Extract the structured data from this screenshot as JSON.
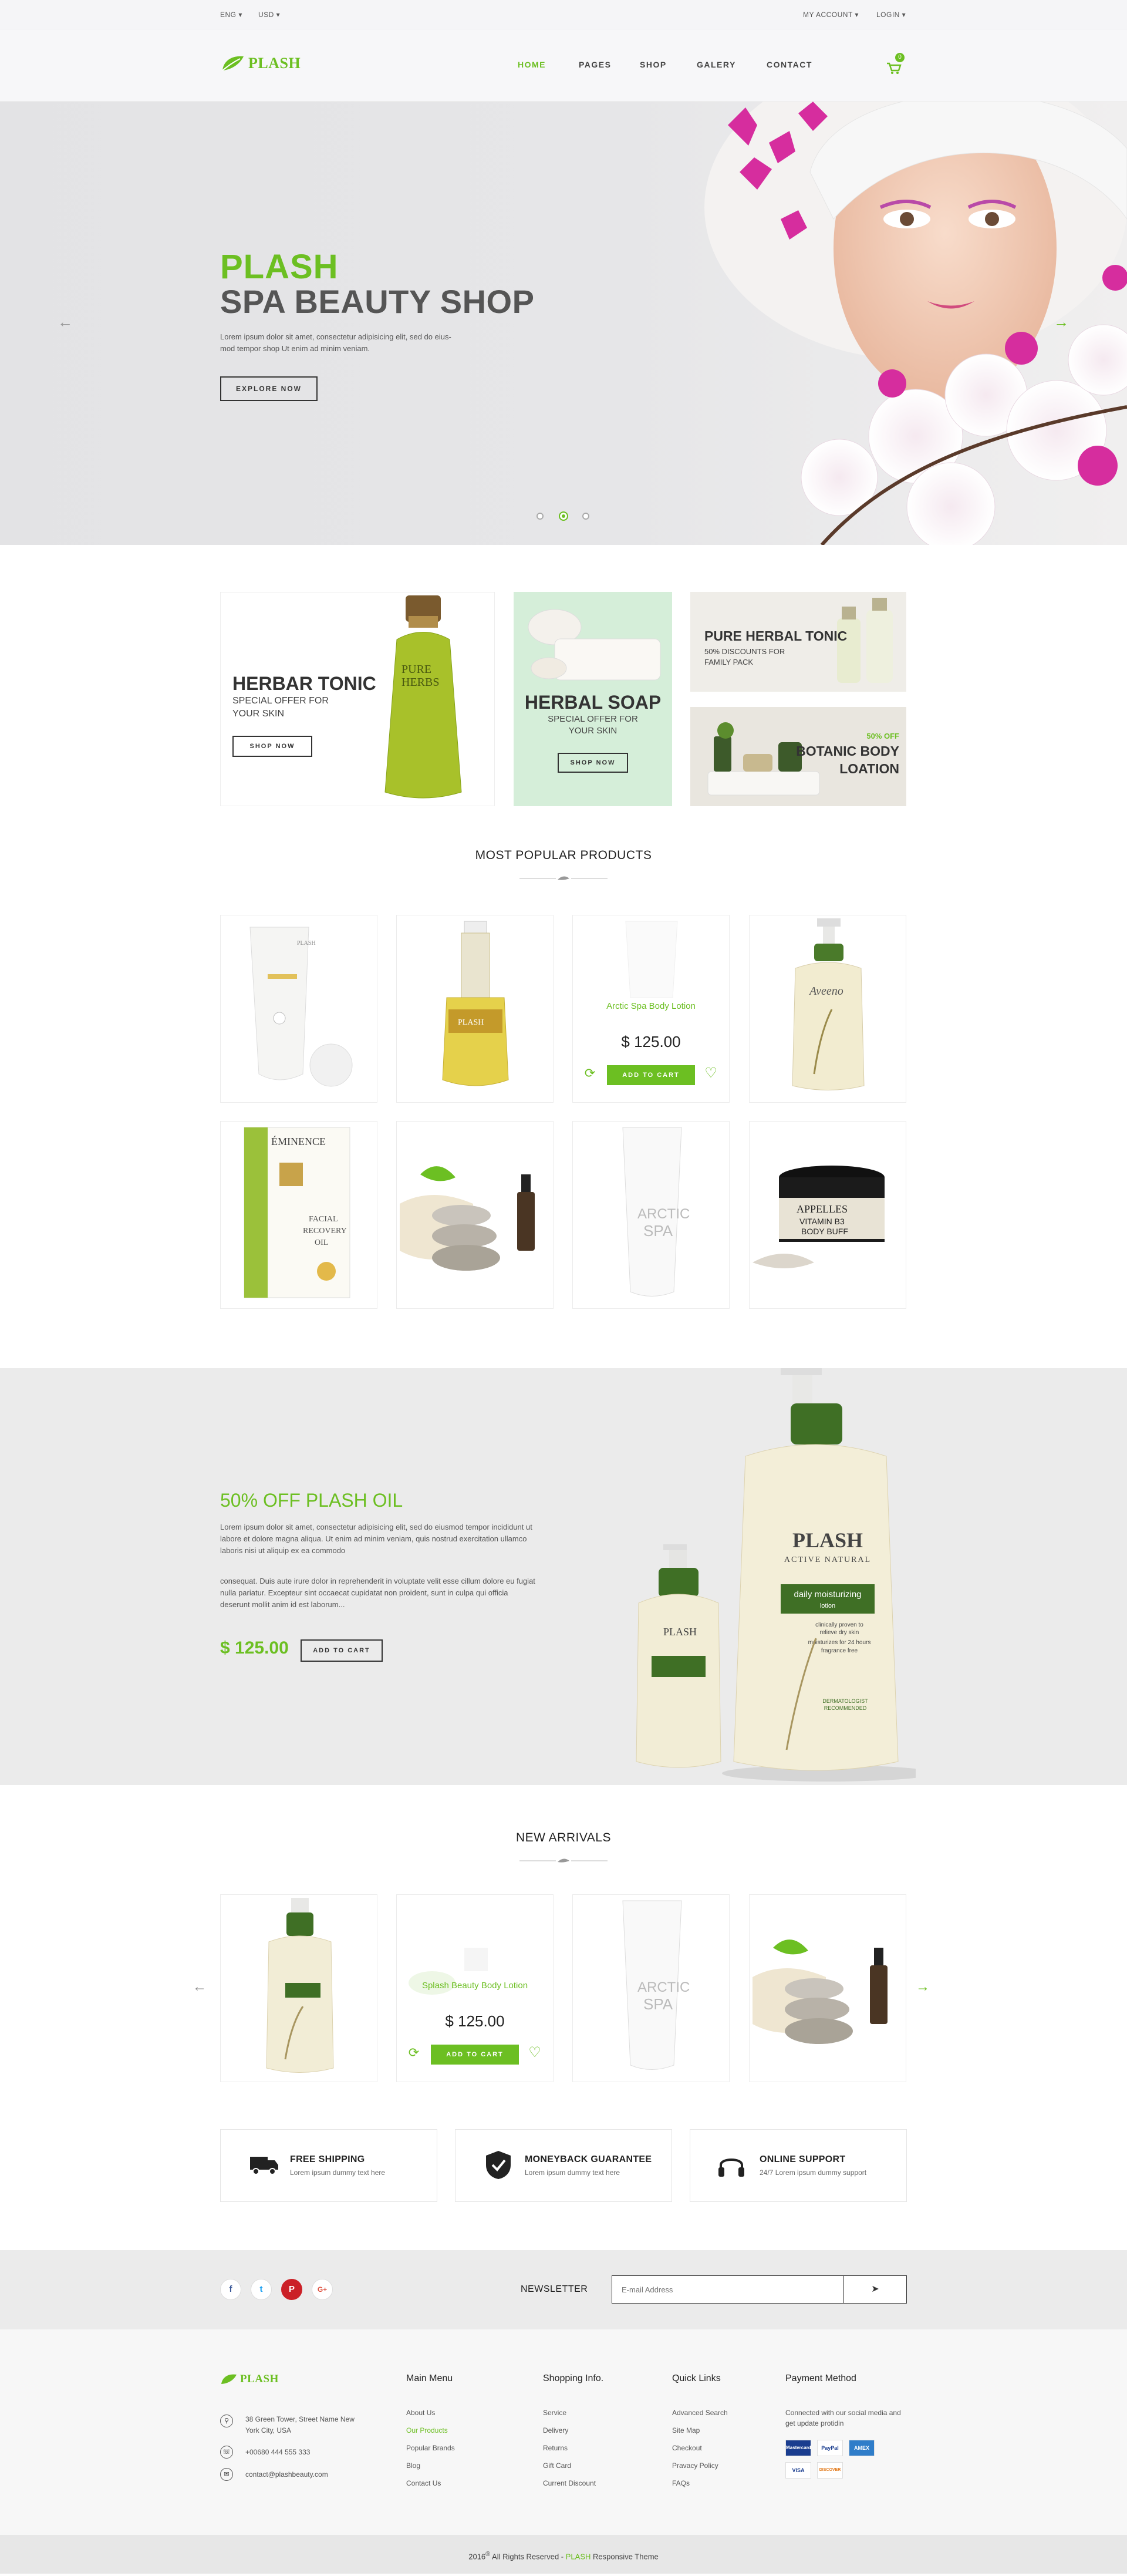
{
  "topbar": {
    "lang": "ENG",
    "currency": "USD",
    "account": "MY ACCOUNT",
    "login": "LOGIN"
  },
  "header": {
    "logo": "PLASH",
    "nav": [
      "HOME",
      "PAGES",
      "SHOP",
      "GALERY",
      "CONTACT"
    ],
    "cart_count": "0"
  },
  "hero": {
    "title_accent": "PLASH",
    "title_main": "SPA BEAUTY SHOP",
    "text_line1": "Lorem ipsum dolor sit amet, consectetur adipisicing elit, sed do eius-",
    "text_line2": "mod tempor shop Ut enim ad minim veniam.",
    "cta": "EXPLORE NOW",
    "slide_active": 2,
    "slide_count": 3
  },
  "promos": {
    "tonic": {
      "title": "HERBAR TONIC",
      "sub1": "SPECIAL OFFER FOR",
      "sub2": "YOUR SKIN",
      "cta": "SHOP NOW",
      "label1": "PURE",
      "label2": "HERBS"
    },
    "soap": {
      "title": "HERBAL SOAP",
      "sub1": "SPECIAL OFFER FOR",
      "sub2": "YOUR SKIN",
      "cta": "SHOP NOW"
    },
    "pure": {
      "title": "PURE HERBAL TONIC",
      "sub1": "50% DISCOUNTS FOR",
      "sub2": "FAMILY PACK"
    },
    "botanic": {
      "badge": "50% OFF",
      "title1": "BOTANIC BODY",
      "title2": "LOATION"
    }
  },
  "popular": {
    "title": "MOST POPULAR PRODUCTS",
    "hover_name": "Arctic Spa Body Lotion",
    "hover_price": "$ 125.00",
    "add_to_cart": "ADD TO CART",
    "labels": {
      "tube1": "PLASH",
      "serum": "PLASH",
      "aveeno": "Aveeno",
      "eminence1": "ÉMINENCE",
      "eminence2": "FACIAL",
      "eminence3": "RECOVERY",
      "eminence4": "OIL",
      "arctic1": "ARCTIC",
      "arctic2": "SPA",
      "appelles1": "APPELLES",
      "appelles2": "VITAMIN B3",
      "appelles3": "BODY BUFF"
    }
  },
  "offer": {
    "title": "50% OFF PLASH OIL",
    "p1_line1": "Lorem ipsum dolor sit amet, consectetur adipisicing elit, sed do eiusmod tempor incididunt ut",
    "p1_line2": "labore et dolore magna aliqua. Ut enim ad minim veniam, quis nostrud exercitation ullamco",
    "p1_line3": "laboris nisi ut aliquip ex ea commodo",
    "p2_line1": "consequat. Duis aute irure dolor in reprehenderit in voluptate velit esse cillum dolore eu fugiat",
    "p2_line2": "nulla pariatur. Excepteur sint occaecat cupidatat non proident, sunt in culpa qui officia",
    "p2_line3": "deserunt mollit anim id est laborum...",
    "price": "$ 125.00",
    "cta": "ADD TO CART",
    "bottle_brand": "PLASH",
    "bottle_sub": "ACTIVE NATURAL",
    "bottle_label1": "daily moisturizing",
    "bottle_label2": "lotion",
    "bottle_claim1": "clinically proven to",
    "bottle_claim2": "relieve dry skin",
    "bottle_claim3": "moisturizes for 24 hours",
    "bottle_claim4": "fragrance free",
    "bottle_badge1": "DERMATOLOGIST",
    "bottle_badge2": "RECOMMENDED"
  },
  "arrivals": {
    "title": "NEW ARRIVALS",
    "hover_name": "Splash Beauty Body Lotion",
    "hover_price": "$ 125.00",
    "add_to_cart": "ADD TO CART"
  },
  "features": [
    {
      "title": "FREE SHIPPING",
      "sub": "Lorem ipsum dummy text here"
    },
    {
      "title": "MONEYBACK GUARANTEE",
      "sub": "Lorem ipsum dummy text here"
    },
    {
      "title": "ONLINE SUPPORT",
      "sub": "24/7 Lorem ipsum dummy support"
    }
  ],
  "newsletter": {
    "label": "NEWSLETTER",
    "placeholder": "E-mail Address"
  },
  "footer": {
    "logo": "PLASH",
    "address1": "38 Green Tower, Street Name New",
    "address2": "York City, USA",
    "phone": "+00680 444 555 333",
    "email": "contact@plashbeauty.com",
    "col_menu": {
      "title": "Main Menu",
      "links": [
        "About Us",
        "Our Products",
        "Popular Brands",
        "Blog",
        "Contact Us"
      ]
    },
    "col_shop": {
      "title": "Shopping Info.",
      "links": [
        "Service",
        "Delivery",
        "Returns",
        "Gift Card",
        "Current Discount"
      ]
    },
    "col_quick": {
      "title": "Quick Links",
      "links": [
        "Advanced Search",
        "Site Map",
        "Checkout",
        "Pravacy Policy",
        "FAQs"
      ]
    },
    "col_pay": {
      "title": "Payment Method",
      "text1": "Connected with our social media and",
      "text2": "get update protidin",
      "cards": [
        "Mastercard",
        "PayPal",
        "AMEX",
        "VISA",
        "DISCOVER"
      ]
    }
  },
  "copyright": {
    "pre": "2016",
    "reg": "®",
    "mid": " All Rights Reserved - ",
    "brand": "PLASH",
    "post": " Responsive Theme"
  },
  "colors": {
    "accent": "#6cbf22",
    "dark": "#333333",
    "pink": "#d62d9e"
  }
}
